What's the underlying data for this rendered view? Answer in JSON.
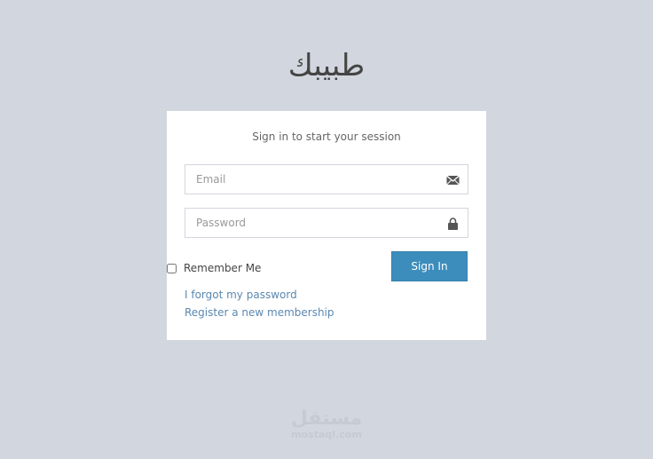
{
  "logo": {
    "text": "طبيبك"
  },
  "login": {
    "message": "Sign in to start your session",
    "email": {
      "placeholder": "Email",
      "value": ""
    },
    "password": {
      "placeholder": "Password",
      "value": ""
    },
    "remember_label": "Remember Me",
    "remember_checked": false,
    "signin_label": "Sign In",
    "forgot_link": "I forgot my password",
    "register_link": "Register a new membership"
  },
  "watermark": {
    "arabic": "مستقل",
    "latin": "mostaql.com"
  },
  "colors": {
    "background": "#d2d6de",
    "primary": "#3c8dbc",
    "link": "#5b88b0"
  },
  "icons": {
    "email": "envelope-icon",
    "password": "lock-icon"
  }
}
